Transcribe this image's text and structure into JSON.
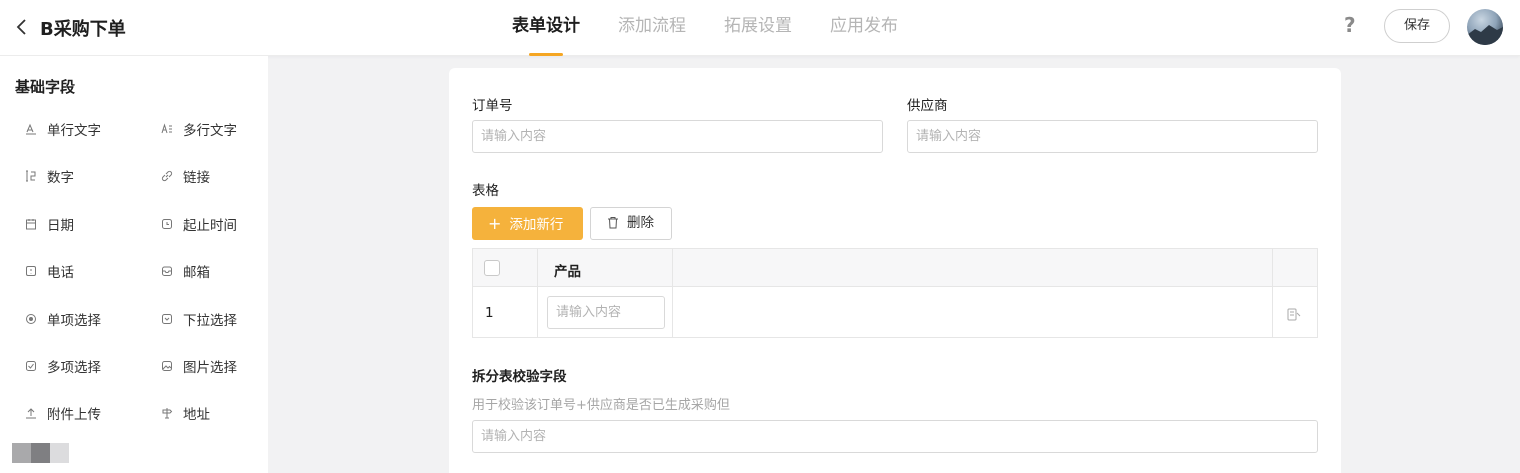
{
  "header": {
    "title": "B采购下单",
    "tabs": [
      {
        "label": "表单设计",
        "active": true
      },
      {
        "label": "添加流程",
        "active": false
      },
      {
        "label": "拓展设置",
        "active": false
      },
      {
        "label": "应用发布",
        "active": false
      }
    ],
    "help": "?",
    "save_label": "保存",
    "accent_color": "#f5a623"
  },
  "sidebar": {
    "title": "基础字段",
    "fields": [
      {
        "label": "单行文字",
        "icon": "single-line-text-icon"
      },
      {
        "label": "多行文字",
        "icon": "multi-line-text-icon"
      },
      {
        "label": "数字",
        "icon": "number-icon"
      },
      {
        "label": "链接",
        "icon": "link-icon"
      },
      {
        "label": "日期",
        "icon": "calendar-icon"
      },
      {
        "label": "起止时间",
        "icon": "time-range-icon"
      },
      {
        "label": "电话",
        "icon": "phone-icon"
      },
      {
        "label": "邮箱",
        "icon": "mail-icon"
      },
      {
        "label": "单项选择",
        "icon": "radio-icon"
      },
      {
        "label": "下拉选择",
        "icon": "dropdown-icon"
      },
      {
        "label": "多项选择",
        "icon": "checkbox-icon"
      },
      {
        "label": "图片选择",
        "icon": "image-icon"
      },
      {
        "label": "附件上传",
        "icon": "upload-icon"
      },
      {
        "label": "地址",
        "icon": "location-icon"
      }
    ]
  },
  "form": {
    "order_no": {
      "label": "订单号",
      "placeholder": "请输入内容"
    },
    "supplier": {
      "label": "供应商",
      "placeholder": "请输入内容"
    },
    "table": {
      "label": "表格",
      "add_row_label": "添加新行",
      "delete_label": "删除",
      "columns": [
        "产品"
      ],
      "rows": [
        {
          "index": "1",
          "placeholder": "请输入内容"
        }
      ]
    },
    "split_field": {
      "label": "拆分表校验字段",
      "hint": "用于校验该订单号+供应商是否已生成采购但",
      "placeholder": "请输入内容"
    }
  }
}
